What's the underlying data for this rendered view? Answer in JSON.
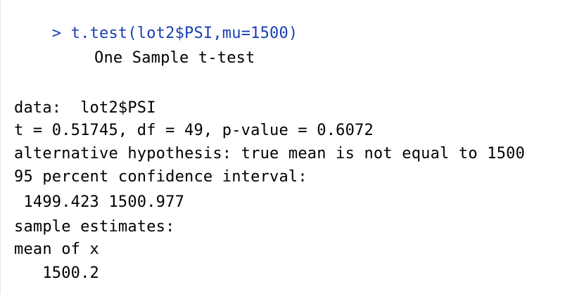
{
  "console": {
    "prompt": ">",
    "command": "t.test(lot2$PSI,mu=1500)",
    "output": {
      "title": "One Sample t-test",
      "data_line": "data:  lot2$PSI",
      "stats_line": "t = 0.51745, df = 49, p-value = 0.6072",
      "alt_hypothesis": "alternative hypothesis: true mean is not equal to 1500",
      "ci_label": "95 percent confidence interval:",
      "ci_values": " 1499.423 1500.977",
      "estimates_label": "sample estimates:",
      "estimate_name": "mean of x",
      "estimate_value": "   1500.2"
    }
  },
  "colors": {
    "command": "#1a3fb3",
    "output": "#000000",
    "background": "#ffffff"
  }
}
